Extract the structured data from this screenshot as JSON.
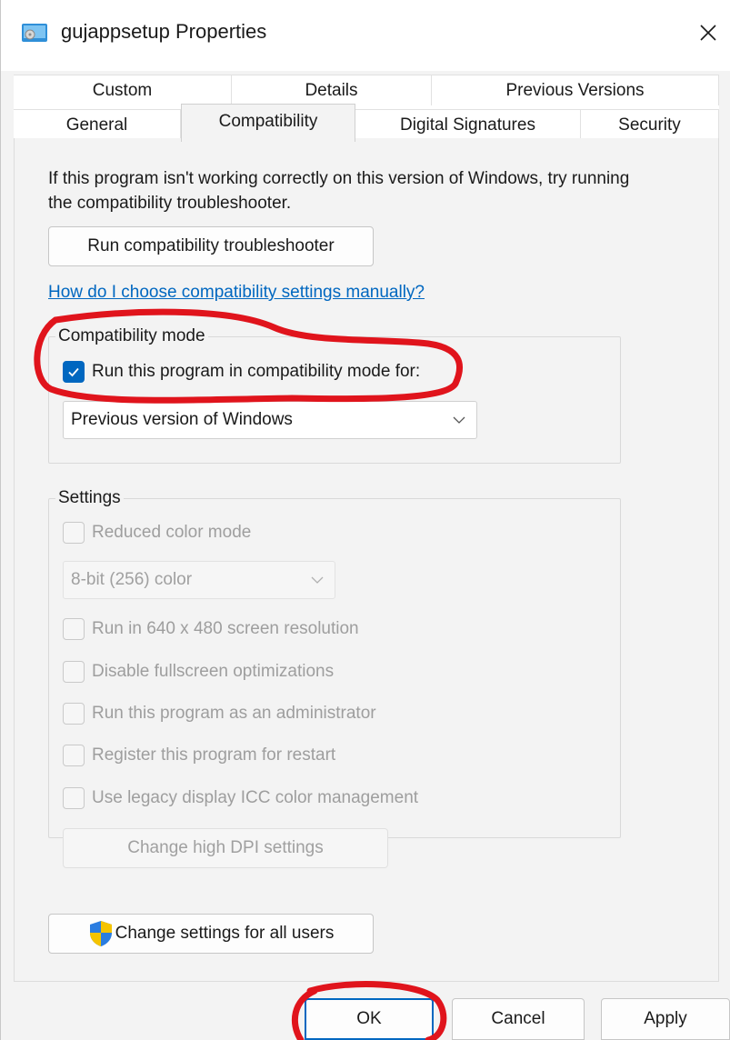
{
  "window": {
    "title": "gujappsetup Properties"
  },
  "tabs": {
    "row1": [
      "Custom",
      "Details",
      "Previous Versions"
    ],
    "row2": [
      "General",
      "Compatibility",
      "Digital Signatures",
      "Security"
    ]
  },
  "intro_text": "If this program isn't working correctly on this version of Windows, try running the compatibility troubleshooter.",
  "troubleshooter_button": "Run compatibility troubleshooter",
  "help_link": "How do I choose compatibility settings manually?",
  "compat_mode": {
    "group_label": "Compatibility mode",
    "checkbox_label": "Run this program in compatibility mode for:",
    "checked": true,
    "selected_os": "Previous version of Windows"
  },
  "settings": {
    "group_label": "Settings",
    "reduced_color": "Reduced color mode",
    "color_depth": "8-bit (256) color",
    "res_640": "Run in 640 x 480 screen resolution",
    "disable_fullscreen": "Disable fullscreen optimizations",
    "run_admin": "Run this program as an administrator",
    "register_restart": "Register this program for restart",
    "legacy_icc": "Use legacy display ICC color management",
    "high_dpi_button": "Change high DPI settings"
  },
  "all_users_button": "Change settings for all users",
  "footer": {
    "ok": "OK",
    "cancel": "Cancel",
    "apply": "Apply"
  },
  "colors": {
    "accent": "#0067c0",
    "annotation": "#e0141c",
    "panel": "#f3f3f3"
  }
}
